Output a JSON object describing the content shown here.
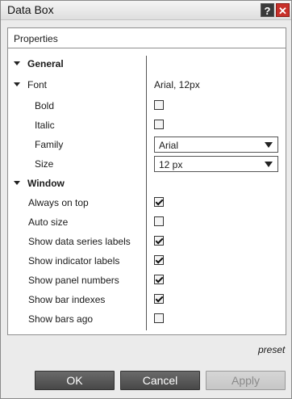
{
  "window": {
    "title": "Data Box",
    "help_label": "?",
    "close_label": "✕"
  },
  "panel": {
    "header": "Properties"
  },
  "sections": {
    "general": "General",
    "font": "Font",
    "font_value": "Arial, 12px",
    "window": "Window"
  },
  "font_props": {
    "bold": {
      "label": "Bold",
      "checked": false
    },
    "italic": {
      "label": "Italic",
      "checked": false
    },
    "family": {
      "label": "Family",
      "value": "Arial"
    },
    "size": {
      "label": "Size",
      "value": "12 px"
    }
  },
  "window_props": {
    "always_on_top": {
      "label": "Always on top",
      "checked": true
    },
    "auto_size": {
      "label": "Auto size",
      "checked": false
    },
    "show_data_series_labels": {
      "label": "Show data series labels",
      "checked": true
    },
    "show_indicator_labels": {
      "label": "Show indicator labels",
      "checked": true
    },
    "show_panel_numbers": {
      "label": "Show panel numbers",
      "checked": true
    },
    "show_bar_indexes": {
      "label": "Show bar indexes",
      "checked": true
    },
    "show_bars_ago": {
      "label": "Show bars ago",
      "checked": false
    }
  },
  "preset_label": "preset",
  "buttons": {
    "ok": "OK",
    "cancel": "Cancel",
    "apply": "Apply"
  },
  "colors": {
    "close_button": "#c8302a",
    "dark_button": "#555555"
  },
  "icons": {
    "help": "help-icon",
    "close": "close-icon",
    "expand": "triangle-down-icon",
    "dropdown": "chevron-down-icon"
  }
}
